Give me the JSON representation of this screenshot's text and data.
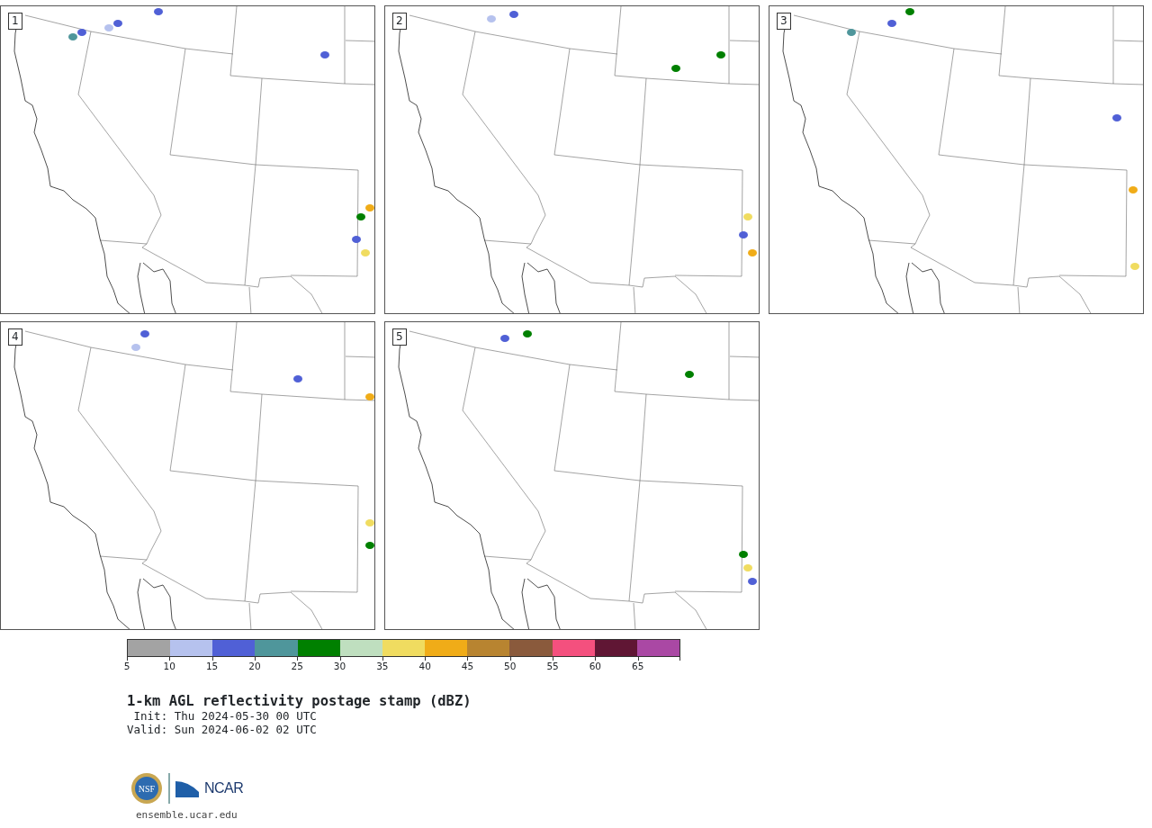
{
  "panels": [
    {
      "label": "1"
    },
    {
      "label": "2"
    },
    {
      "label": "3"
    },
    {
      "label": "4"
    },
    {
      "label": "5"
    }
  ],
  "colorbar": {
    "bins": [
      {
        "color": "#a3a3a3"
      },
      {
        "color": "#b6c2ee"
      },
      {
        "color": "#5060d6"
      },
      {
        "color": "#4f969b"
      },
      {
        "color": "#008000"
      },
      {
        "color": "#bfdfbf"
      },
      {
        "color": "#f0dc60"
      },
      {
        "color": "#f0ac18"
      },
      {
        "color": "#b88430"
      },
      {
        "color": "#8a5a3c"
      },
      {
        "color": "#f4507e"
      },
      {
        "color": "#601634"
      },
      {
        "color": "#aa48a4"
      }
    ],
    "ticks": [
      "5",
      "10",
      "15",
      "20",
      "25",
      "30",
      "35",
      "40",
      "45",
      "50",
      "55",
      "60",
      "65"
    ]
  },
  "title": "1-km AGL reflectivity postage stamp (dBZ)",
  "init": " Init: Thu 2024-05-30 00 UTC",
  "valid": "Valid: Sun 2024-06-02 02 UTC",
  "logos": {
    "nsf": "NSF",
    "ncar": "NCAR"
  },
  "url": "ensemble.ucar.edu"
}
